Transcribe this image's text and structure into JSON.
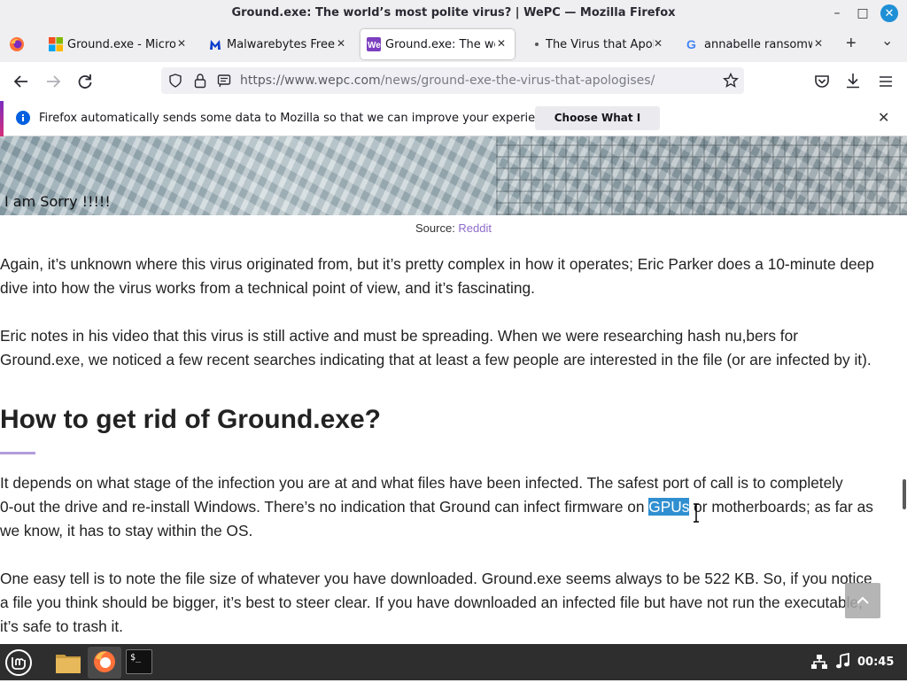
{
  "window": {
    "title": "Ground.exe: The world’s most polite virus? | WePC — Mozilla Firefox",
    "minimize_glyph": "–",
    "maximize_glyph": "□",
    "close_glyph": "✕"
  },
  "tabs": [
    {
      "label": "Ground.exe - Micros",
      "icon": "microsoft-logo-icon"
    },
    {
      "label": "Malwarebytes Free:",
      "icon": "malwarebytes-icon"
    },
    {
      "label": "Ground.exe: The wo",
      "icon": "wepc-icon",
      "active": true
    },
    {
      "label": "The Virus that Apolo",
      "icon": "dot-icon"
    },
    {
      "label": "annabelle ransomwa",
      "icon": "google-icon"
    }
  ],
  "tab_close_glyph": "✕",
  "new_tab_glyph": "+",
  "tab_list_glyph": "⌄",
  "address": {
    "url_host": "https://www.wepc.com",
    "url_path": "/news/ground-exe-the-virus-that-apologises/"
  },
  "notification": {
    "text": "Firefox automatically sends some data to Mozilla so that we can improve your experience.",
    "button": "Choose What I Share",
    "close_glyph": "✕"
  },
  "article": {
    "hero_caption": "I am Sorry !!!!!",
    "source_label": "Source: ",
    "source_link": "Reddit",
    "p1_l1": "Again, it’s unknown where this virus originated from, but it’s pretty complex in how it operates; Eric Parker does a 10-minute deep",
    "p1_l2": "dive into how the virus works from a technical point of view, and it’s fascinating.",
    "p2_l1": "Eric notes in his video that this virus is still active and must be spreading. When we were researching hash nu,bers for",
    "p2_l2": "Ground.exe, we noticed a few recent searches indicating that at least a few people are interested in the file (or are infected by it).",
    "heading": "How to get rid of Ground.exe?",
    "p3_l1": "It depends on what stage of the infection you are at and what files have been infected. The safest port of call is to completely",
    "p3_l2_a": "0-out the drive and re-install Windows. There’s no indication that Ground can infect firmware on ",
    "p3_l2_hl": "GPUs",
    "p3_l2_b": " or motherboards; as far as",
    "p3_l3": "we know, it has to stay within the OS.",
    "p4_l1": "One easy tell is to note the file size of whatever you have downloaded. Ground.exe seems always to be 522 KB. So, if you notice",
    "p4_l2": "a file you think should be bigger, it’s best to steer clear. If you have downloaded an infected file but have not run the executable,",
    "p4_l3": "it’s safe to trash it."
  },
  "taskbar": {
    "clock": "00:45",
    "terminal_prompt": "$_"
  },
  "colors": {
    "accent": "#1f8fd6",
    "link": "#8e6bc9",
    "selection": "#2f8fd0",
    "taskbar": "#2e2e2e"
  }
}
